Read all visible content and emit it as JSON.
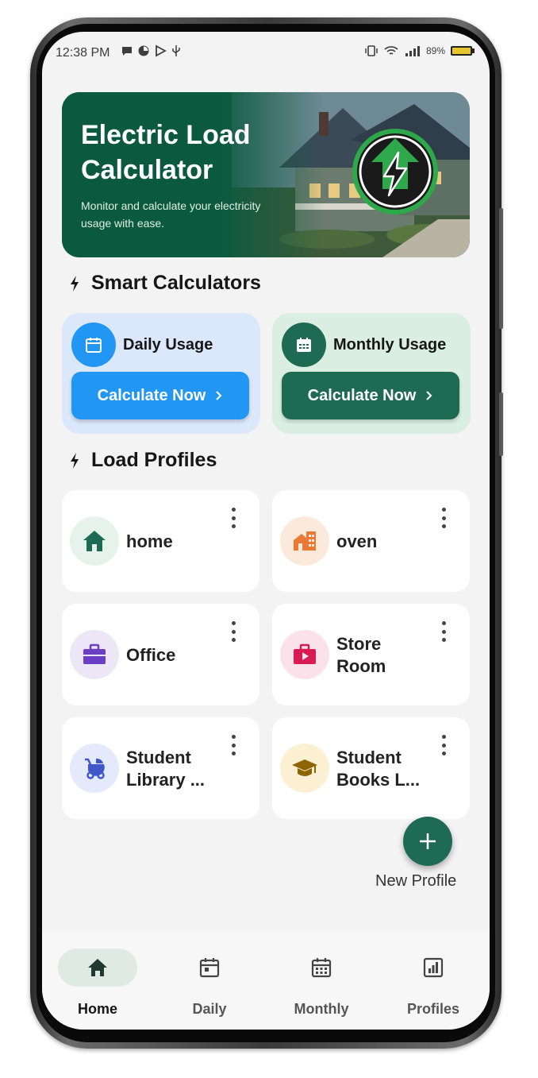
{
  "status_bar": {
    "time": "12:38 PM",
    "battery": "89%"
  },
  "hero": {
    "title": "Electric Load Calculator",
    "subtitle": "Monitor and calculate your electricity usage with ease."
  },
  "smart_calculators": {
    "heading": "Smart Calculators",
    "daily": {
      "label": "Daily Usage",
      "cta": "Calculate Now",
      "icon": "calendar-icon"
    },
    "monthly": {
      "label": "Monthly Usage",
      "cta": "Calculate Now",
      "icon": "calendar-grid-icon"
    }
  },
  "load_profiles": {
    "heading": "Load Profiles",
    "items": [
      {
        "name": "home",
        "icon": "home-icon",
        "color": "#1e6a53",
        "bg": "#e6f3ec"
      },
      {
        "name": "oven",
        "icon": "building-icon",
        "color": "#e97a35",
        "bg": "#fbe9db"
      },
      {
        "name": "Office",
        "icon": "briefcase-icon",
        "color": "#6a3fc4",
        "bg": "#ece6f7"
      },
      {
        "name": "Store Room",
        "icon": "video-bag-icon",
        "color": "#d81b55",
        "bg": "#fbe2ea"
      },
      {
        "name": "Student Library ...",
        "icon": "stroller-icon",
        "color": "#3f57c9",
        "bg": "#e4e9fb"
      },
      {
        "name": "Student Books L...",
        "icon": "graduation-cap-icon",
        "color": "#8d6400",
        "bg": "#fbf0d2"
      }
    ]
  },
  "fab": {
    "label": "New Profile"
  },
  "bottom_nav": {
    "items": [
      {
        "label": "Home",
        "icon": "home-icon",
        "active": true
      },
      {
        "label": "Daily",
        "icon": "calendar-icon",
        "active": false
      },
      {
        "label": "Monthly",
        "icon": "calendar-grid-icon",
        "active": false
      },
      {
        "label": "Profiles",
        "icon": "chart-icon",
        "active": false
      }
    ]
  }
}
